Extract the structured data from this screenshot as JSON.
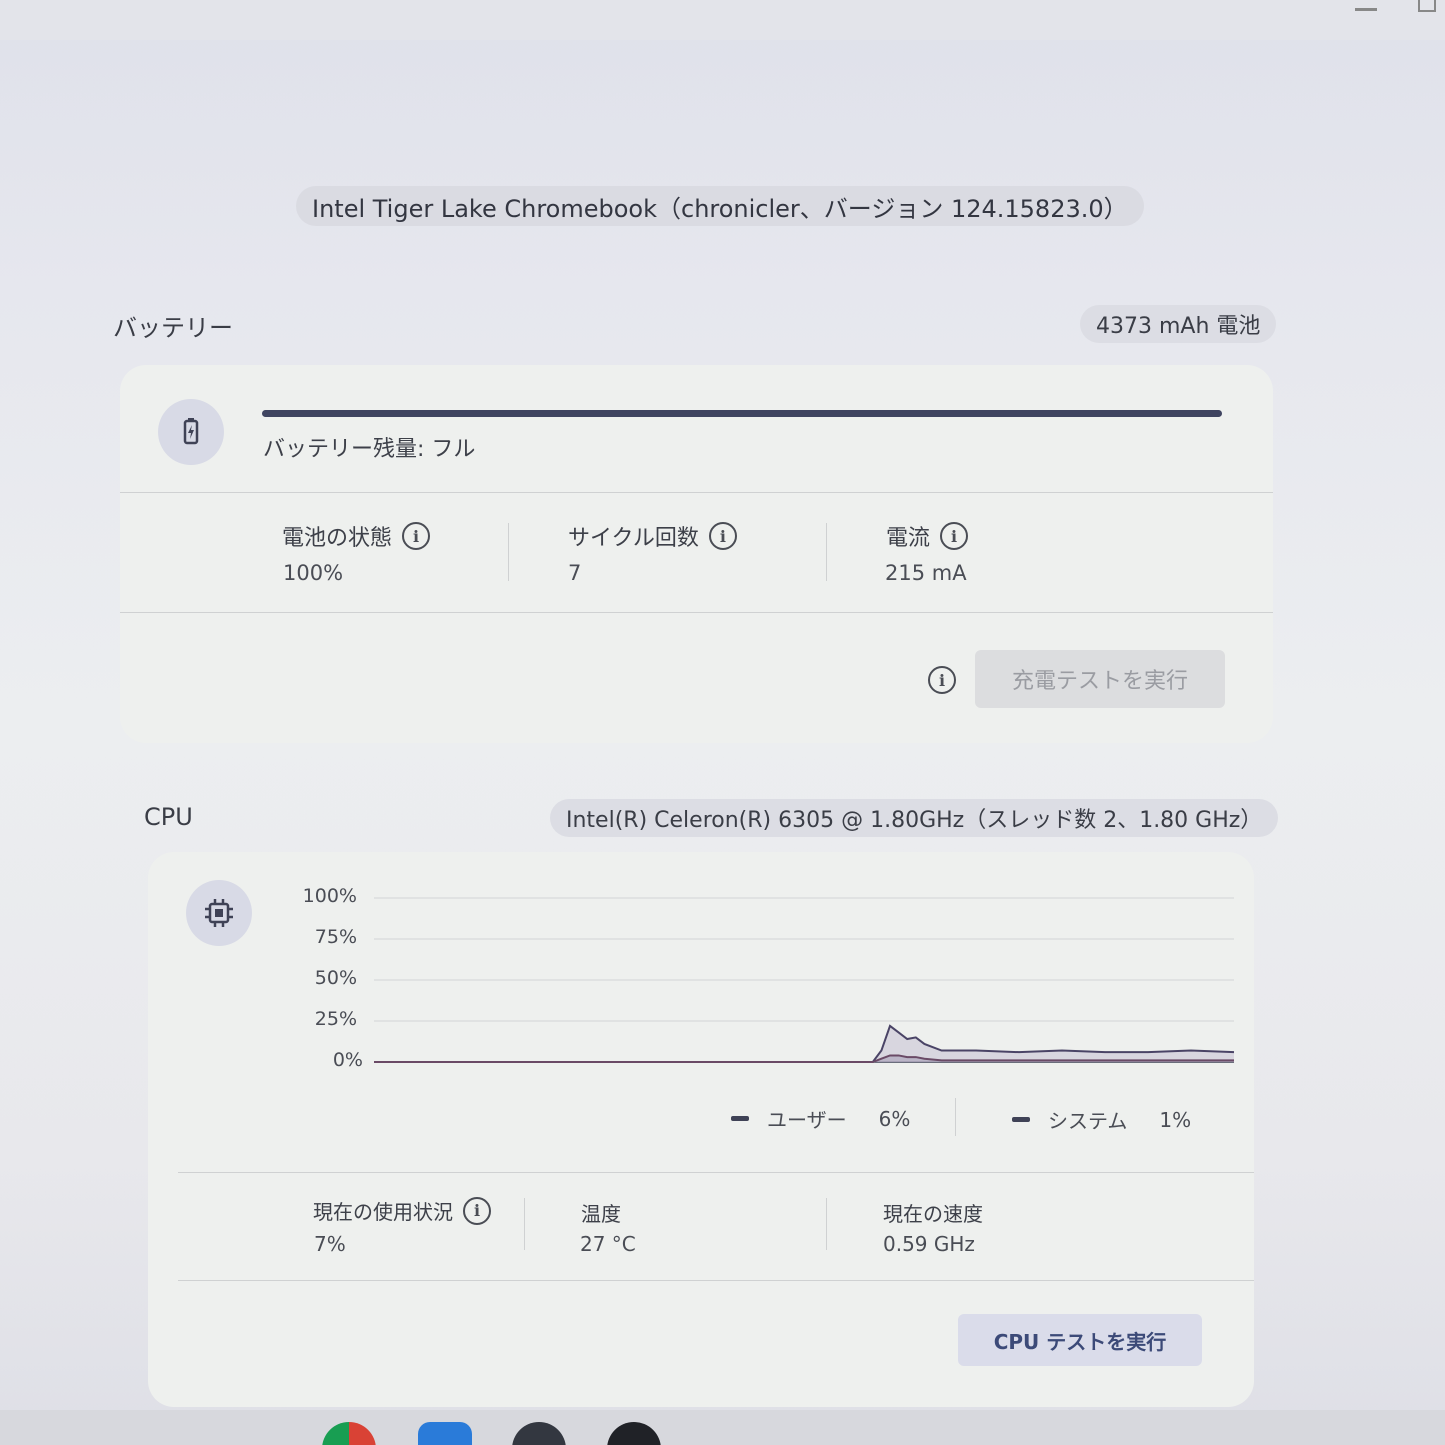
{
  "device": {
    "title": "Intel Tiger Lake Chromebook（chronicler、バージョン 124.15823.0）"
  },
  "battery": {
    "section_title": "バッテリー",
    "capacity_chip": "4373 mAh 電池",
    "level_fraction": 1.0,
    "level_label": "バッテリー残量: フル",
    "stats": [
      {
        "label": "電池の状態",
        "value": "100%"
      },
      {
        "label": "サイクル回数",
        "value": "7"
      },
      {
        "label": "電流",
        "value": "215 mA"
      }
    ],
    "test_button": "充電テストを実行"
  },
  "cpu": {
    "section_title": "CPU",
    "model_chip": "Intel(R) Celeron(R) 6305 @ 1.80GHz（スレッド数 2、1.80 GHz）",
    "legend": [
      {
        "name": "ユーザー",
        "value": "6%"
      },
      {
        "name": "システム",
        "value": "1%"
      }
    ],
    "stats": [
      {
        "label": "現在の使用状況",
        "value": "7%"
      },
      {
        "label": "温度",
        "value": "27 °C"
      },
      {
        "label": "現在の速度",
        "value": "0.59 GHz"
      }
    ],
    "test_button": "CPU テストを実行"
  },
  "chart_data": {
    "type": "area",
    "yticks": [
      "100%",
      "75%",
      "50%",
      "25%",
      "0%"
    ],
    "ylim": [
      0,
      100
    ],
    "x": [
      0,
      10,
      20,
      30,
      40,
      50,
      58,
      59,
      60,
      61,
      62,
      63,
      64,
      66,
      68,
      70,
      75,
      80,
      85,
      90,
      95,
      100
    ],
    "series": [
      {
        "name": "ユーザー",
        "values": [
          0,
          0,
          0,
          0,
          0,
          0,
          0,
          7,
          22,
          18,
          14,
          15,
          11,
          7,
          7,
          7,
          6,
          7,
          6,
          6,
          7,
          6
        ]
      },
      {
        "name": "システム",
        "values": [
          0,
          0,
          0,
          0,
          0,
          0,
          0,
          2,
          4,
          4,
          3,
          3,
          2,
          1,
          1,
          1,
          1,
          1,
          1,
          1,
          1,
          1
        ]
      }
    ],
    "grid": true
  },
  "icons": {
    "battery": "battery-charging-icon",
    "cpu": "cpu-chip-icon",
    "info": "info-icon"
  }
}
